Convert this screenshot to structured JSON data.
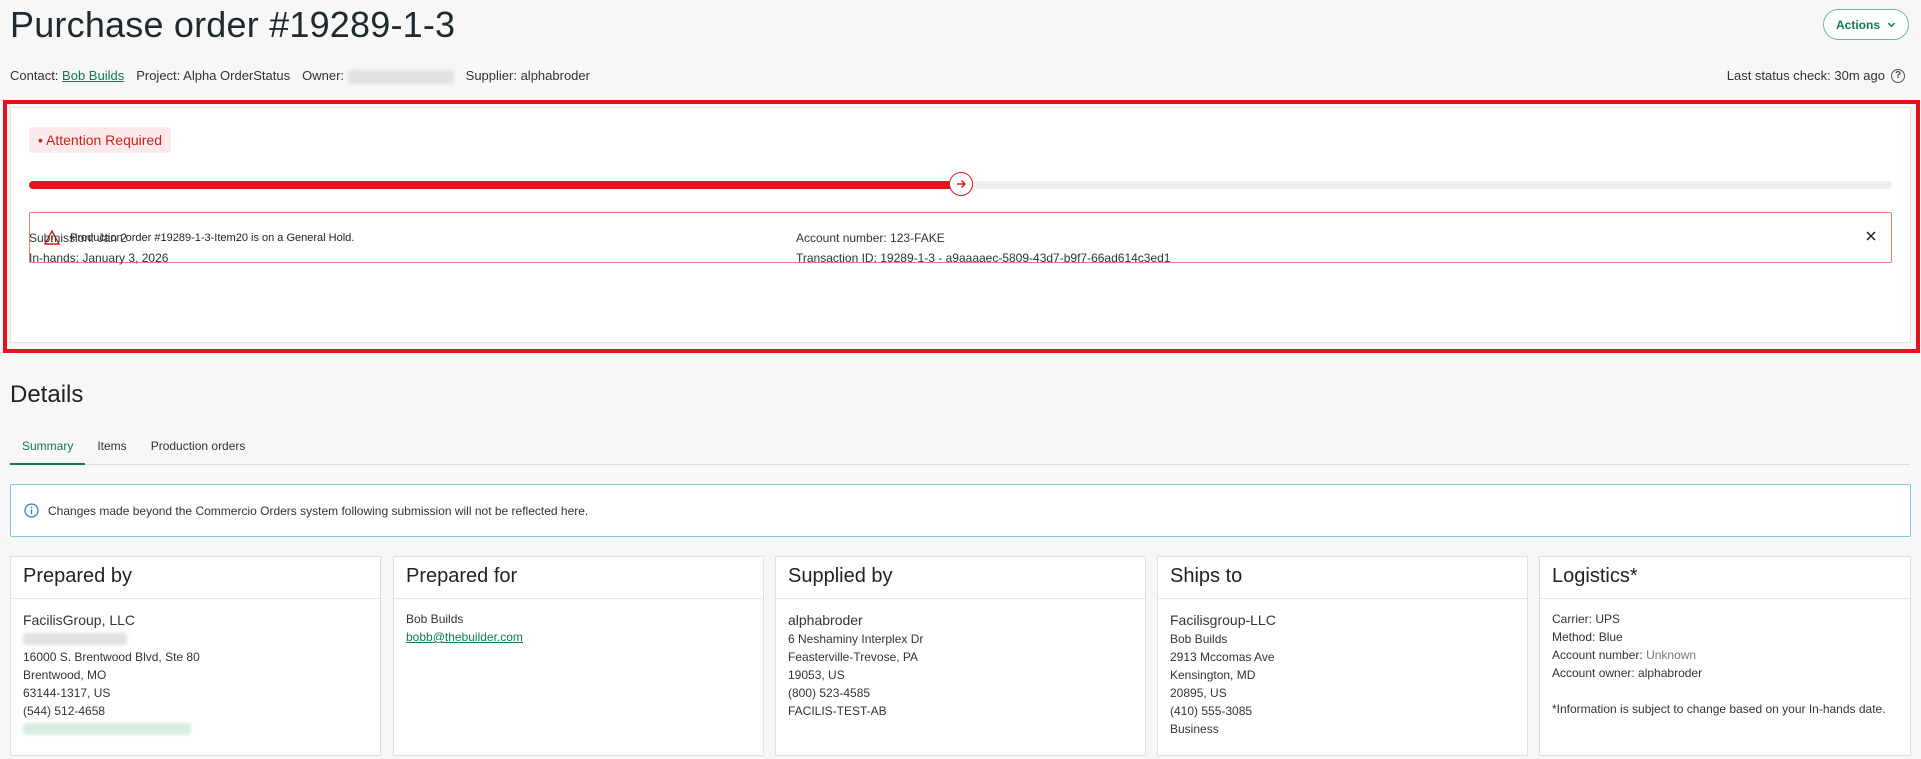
{
  "page": {
    "title": "Purchase order #19289-1-3",
    "actions_label": "Actions"
  },
  "meta": {
    "contact_label": "Contact:",
    "contact_value": "Bob Builds",
    "project_label": "Project: Alpha OrderStatus",
    "owner_label": "Owner:",
    "supplier_label": "Supplier: alphabroder",
    "last_status_check": "Last status check: 30m ago"
  },
  "status": {
    "badge": "Attention Required",
    "progress_fraction": 0.5,
    "alert_message": "Production order #19289-1-3-Item20 is on a General Hold.",
    "submission": "Submission: Jan 2",
    "in_hands": "In-hands: January 3, 2026",
    "account_number": "Account number: 123-FAKE",
    "transaction_id": "Transaction ID: 19289-1-3 - a9aaaaec-5809-43d7-b9f7-66ad614c3ed1"
  },
  "details": {
    "heading": "Details",
    "tabs": [
      "Summary",
      "Items",
      "Production orders"
    ],
    "active_tab": "Summary",
    "info_message": "Changes made beyond the Commercio Orders system following submission will not be reflected here."
  },
  "cards": {
    "prepared_by": {
      "title": "Prepared by",
      "company": "FacilisGroup, LLC",
      "address1": "16000 S. Brentwood Blvd, Ste 80",
      "address2": "Brentwood, MO",
      "address3": "63144-1317, US",
      "phone": "(544) 512-4658"
    },
    "prepared_for": {
      "title": "Prepared for",
      "name": "Bob Builds",
      "email": "bobb@thebuilder.com"
    },
    "supplied_by": {
      "title": "Supplied by",
      "company": "alphabroder",
      "address1": "6 Neshaminy Interplex Dr",
      "address2": "Feasterville-Trevose, PA",
      "address3": "19053, US",
      "phone": "(800) 523-4585",
      "code": "FACILIS-TEST-AB"
    },
    "ships_to": {
      "title": "Ships to",
      "company": "Facilisgroup-LLC",
      "name": "Bob Builds",
      "address1": "2913 Mccomas Ave",
      "address2": "Kensington, MD",
      "address3": "20895, US",
      "phone": "(410) 555-3085",
      "type": "Business"
    },
    "logistics": {
      "title": "Logistics*",
      "carrier": "Carrier: UPS",
      "method": "Method: Blue",
      "account_number_label": "Account number: ",
      "account_number_value": "Unknown",
      "account_owner": "Account owner: alphabroder",
      "note": "*Information is subject to change based on your In-hands date."
    }
  },
  "colors": {
    "brand_green": "#0e7a55",
    "alert_red": "#d91b1b",
    "highlight_red": "#e3141b",
    "info_blue": "#88c2e0"
  }
}
